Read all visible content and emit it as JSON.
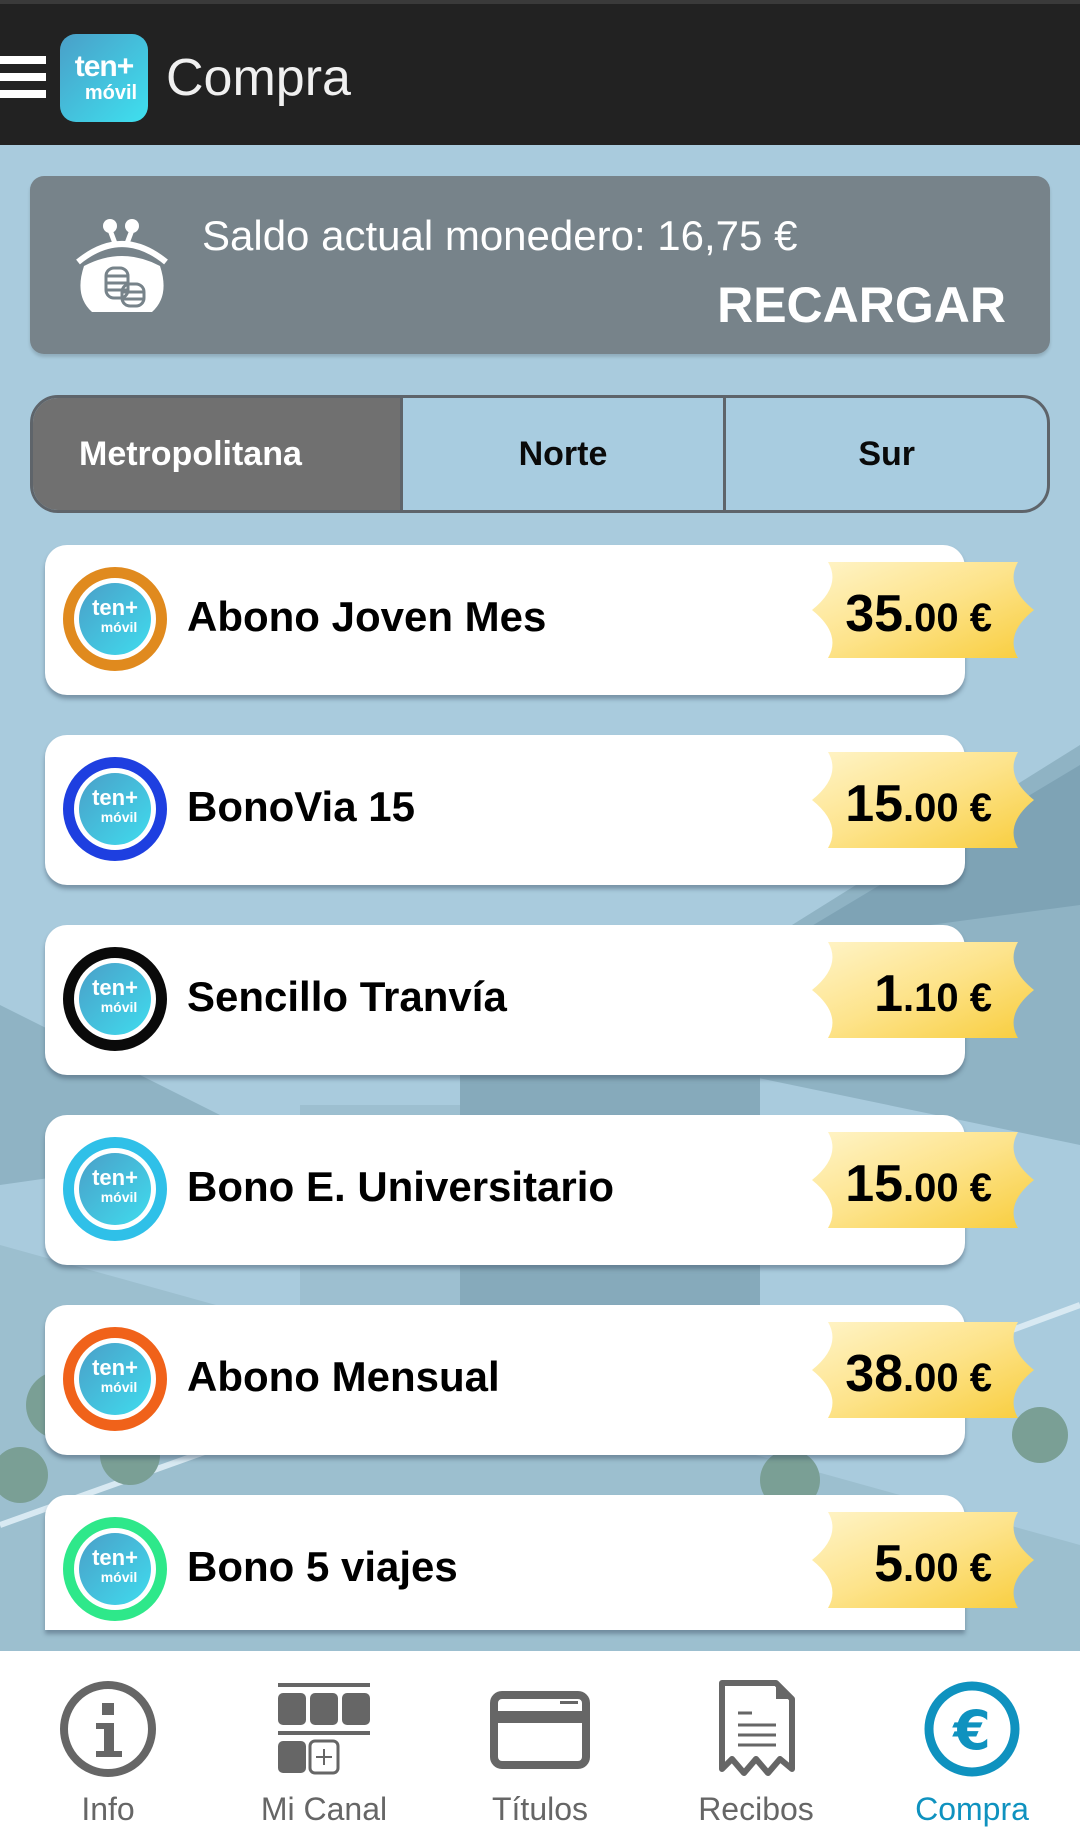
{
  "appbar": {
    "title": "Compra",
    "logo_line1": "ten+",
    "logo_line2": "móvil"
  },
  "balance": {
    "label": "Saldo actual monedero: 16,75 €",
    "action": "RECARGAR"
  },
  "tabs": [
    {
      "label": "Metropolitana",
      "active": true
    },
    {
      "label": "Norte",
      "active": false
    },
    {
      "label": "Sur",
      "active": false
    }
  ],
  "products": [
    {
      "name": "Abono Joven Mes",
      "price_int": "35",
      "price_dec": ".00 €",
      "ring_color": "#e08a1e"
    },
    {
      "name": "BonoVia 15",
      "price_int": "15",
      "price_dec": ".00 €",
      "ring_color": "#1e3fe0"
    },
    {
      "name": "Sencillo Tranvía",
      "price_int": "1",
      "price_dec": ".10 €",
      "ring_color": "#0a0a0a"
    },
    {
      "name": "Bono E. Universitario",
      "price_int": "15",
      "price_dec": ".00 €",
      "ring_color": "#2fc0e8"
    },
    {
      "name": "Abono Mensual",
      "price_int": "38",
      "price_dec": ".00 €",
      "ring_color": "#f0621a"
    },
    {
      "name": "Bono 5 viajes",
      "price_int": "5",
      "price_dec": ".00 €",
      "ring_color": "#2ee88a"
    }
  ],
  "badge": {
    "line1": "ten+",
    "line2": "móvil"
  },
  "bottom_nav": [
    {
      "label": "Info",
      "icon": "info-icon",
      "active": false
    },
    {
      "label": "Mi Canal",
      "icon": "channel-grid-icon",
      "active": false
    },
    {
      "label": "Títulos",
      "icon": "card-icon",
      "active": false
    },
    {
      "label": "Recibos",
      "icon": "receipt-icon",
      "active": false
    },
    {
      "label": "Compra",
      "icon": "euro-icon",
      "active": true
    }
  ],
  "colors": {
    "accent": "#0f92bf",
    "appbar": "#222222",
    "background": "#a9cbdd",
    "price_tag": "#fbd65a"
  }
}
